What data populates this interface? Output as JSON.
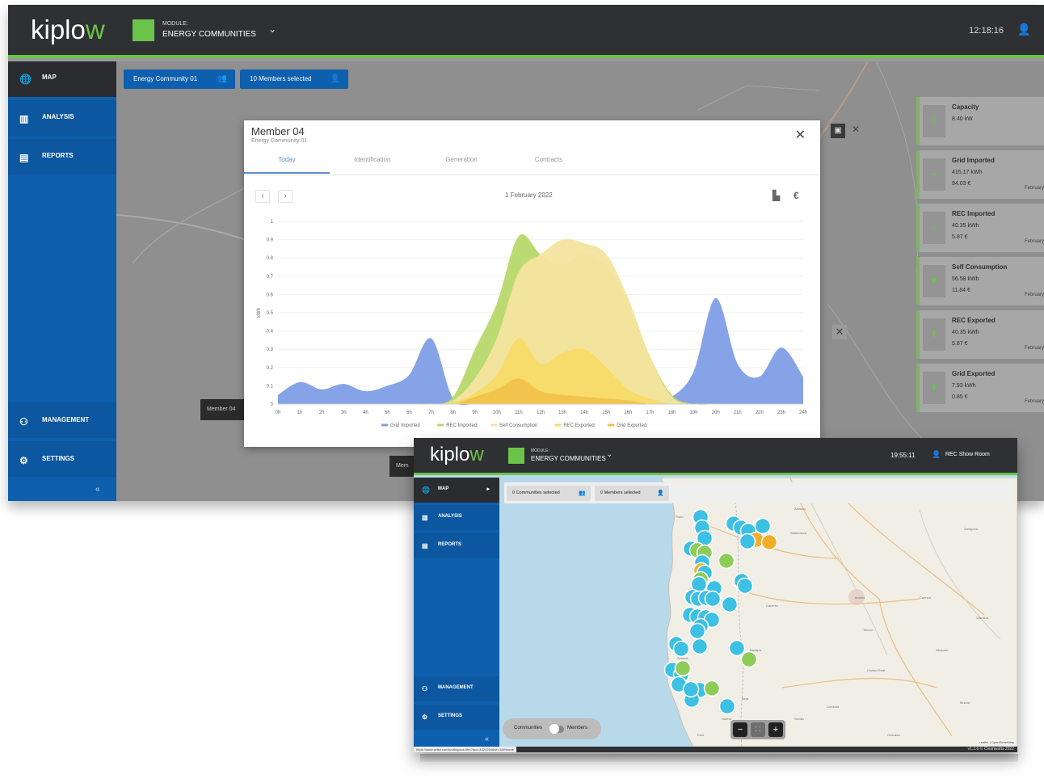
{
  "app": {
    "logo_main": "kiplo",
    "logo_accent": "w",
    "module_label": "MODULE:",
    "module_name": "ENERGY COMMUNITIES"
  },
  "back": {
    "clock": "12:18:16",
    "nav": {
      "map": "MAP",
      "analysis": "ANALYSIS",
      "reports": "REPORTS",
      "management": "MANAGEMENT",
      "settings": "SETTINGS",
      "collapse": "«"
    },
    "chips": {
      "community": "Energy Community 01",
      "members": "10 Members selected"
    },
    "side_cards": [
      {
        "title": "Capacity",
        "v1": "8.40 kW",
        "v2": "",
        "foot": ""
      },
      {
        "title": "Grid Imported",
        "v1": "415.17 kWh",
        "v2": "94.03 €",
        "foot": "February"
      },
      {
        "title": "REC Imported",
        "v1": "40.35 kWh",
        "v2": "5.87 €",
        "foot": "February"
      },
      {
        "title": "Self Consumption",
        "v1": "56.58 kWh",
        "v2": "11.84 €",
        "foot": "February"
      },
      {
        "title": "REC Exported",
        "v1": "40.35 kWh",
        "v2": "5.87 €",
        "foot": "February"
      },
      {
        "title": "Grid Exported",
        "v1": "7.93 kWh",
        "v2": "0.85 €",
        "foot": "February"
      }
    ],
    "tab1": "Member 04",
    "tab2": "Mem"
  },
  "modal": {
    "title": "Member 04",
    "subtitle": "Energy Community 01",
    "tabs": [
      "Today",
      "Identification",
      "Generation",
      "Contracts"
    ],
    "date": "1 February 2022",
    "ylabel": "kWh",
    "legend": [
      "Grid Imported",
      "REC Imported",
      "Self Consumption",
      "REC Exported",
      "Grid Exported"
    ]
  },
  "chart_data": {
    "type": "area",
    "title": "",
    "xlabel": "",
    "ylabel": "kWh",
    "ylim": [
      0,
      1
    ],
    "yticks": [
      "0",
      "0.1",
      "0.2",
      "0.3",
      "0.4",
      "0.5",
      "0.6",
      "0.7",
      "0.8",
      "0.9",
      "1"
    ],
    "x": [
      "0h",
      "1h",
      "2h",
      "3h",
      "4h",
      "5h",
      "6h",
      "7h",
      "8h",
      "9h",
      "10h",
      "11h",
      "12h",
      "13h",
      "14h",
      "15h",
      "16h",
      "17h",
      "18h",
      "19h",
      "20h",
      "21h",
      "22h",
      "23h",
      "24h"
    ],
    "series": [
      {
        "name": "Grid Imported",
        "color": "#7f9ee6",
        "values": [
          0.05,
          0.12,
          0.08,
          0.11,
          0.07,
          0.1,
          0.16,
          0.36,
          0.03,
          0.0,
          0.0,
          0.0,
          0.0,
          0.0,
          0.0,
          0.0,
          0.0,
          0.0,
          0.04,
          0.18,
          0.58,
          0.22,
          0.15,
          0.31,
          0.15
        ]
      },
      {
        "name": "REC Imported",
        "color": "#b7d96a",
        "values": [
          0,
          0,
          0,
          0,
          0,
          0,
          0,
          0,
          0.04,
          0.3,
          0.55,
          0.92,
          0.82,
          0.76,
          0.82,
          0.76,
          0.56,
          0.26,
          0.05,
          0,
          0,
          0,
          0,
          0,
          0
        ]
      },
      {
        "name": "Self Consumption",
        "color": "#f4e49f",
        "values": [
          0,
          0,
          0,
          0,
          0,
          0,
          0,
          0,
          0.02,
          0.14,
          0.36,
          0.72,
          0.82,
          0.9,
          0.88,
          0.82,
          0.58,
          0.26,
          0.04,
          0,
          0,
          0,
          0,
          0,
          0
        ]
      },
      {
        "name": "REC Exported",
        "color": "#f7db68",
        "values": [
          0,
          0,
          0,
          0,
          0,
          0,
          0,
          0,
          0.01,
          0.06,
          0.16,
          0.36,
          0.22,
          0.28,
          0.3,
          0.2,
          0.08,
          0.03,
          0,
          0,
          0,
          0,
          0,
          0,
          0
        ]
      },
      {
        "name": "Grid Exported",
        "color": "#f1c24a",
        "values": [
          0,
          0,
          0,
          0,
          0,
          0,
          0,
          0,
          0,
          0.04,
          0.08,
          0.14,
          0.07,
          0.05,
          0.04,
          0.03,
          0.02,
          0,
          0,
          0,
          0,
          0,
          0,
          0,
          0
        ]
      }
    ]
  },
  "front": {
    "clock": "19:55:11",
    "user": "REC Show Room",
    "nav": {
      "map": "MAP",
      "analysis": "ANALYSIS",
      "reports": "REPORTS",
      "management": "MANAGEMENT",
      "settings": "SETTINGS",
      "collapse": "«"
    },
    "chips": {
      "communities": "0 Communities selected",
      "members": "0 Members selected"
    },
    "toggle": {
      "left": "Communities",
      "right": "Members"
    },
    "map_labels": [
      "Porto",
      "Braga",
      "Coimbra",
      "Lisboa",
      "Setúbal",
      "Faro",
      "Évora",
      "Beja",
      "Badajoz",
      "Cáceres",
      "Salamanca",
      "Zamora",
      "Madrid",
      "Toledo",
      "Ciudad Real",
      "Córdoba",
      "Sevilla",
      "Huelva",
      "Valladolid",
      "Burgos",
      "Zaragoza",
      "Valencia",
      "Murcia",
      "Cuenca",
      "Albacete",
      "Granada"
    ],
    "attribution": "Leaflet | OpenStreetMap",
    "url": "https://www.wrike.com/workspace.htm?acc=4424264&wr=16#/home",
    "version": "v1.2.6 © Cleanwatts 2022"
  },
  "colors": {
    "green": "#6cc34a",
    "blue": "#0e5fae",
    "dark": "#2e3033",
    "marker_cyan": "#3cc0e3",
    "marker_green": "#8dcc57",
    "marker_orange": "#f2ad29"
  }
}
